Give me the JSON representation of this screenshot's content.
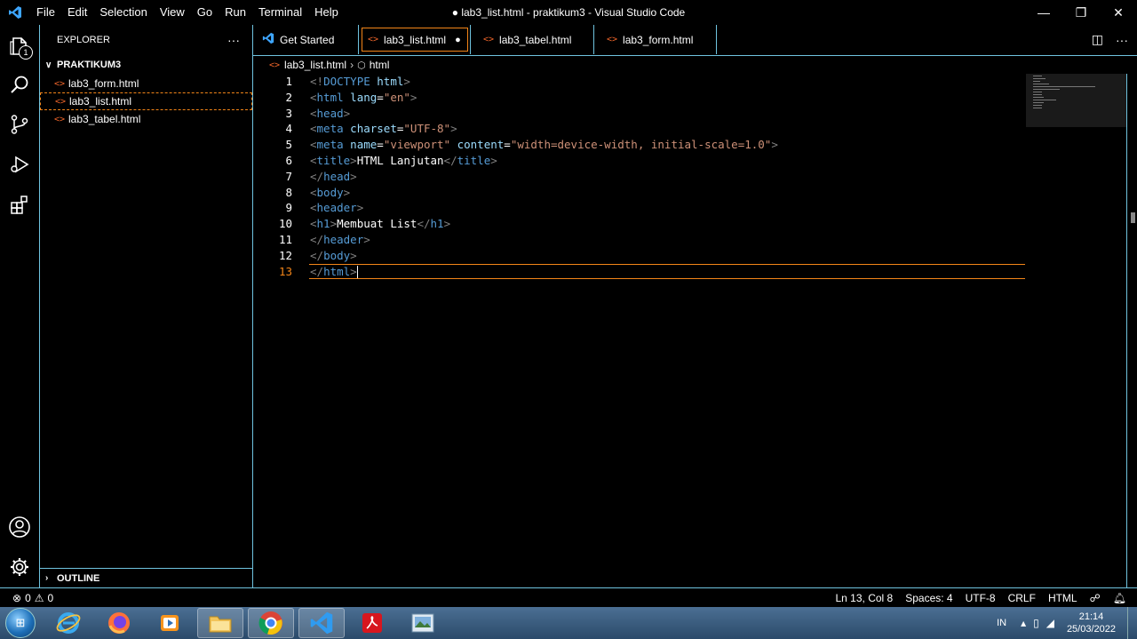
{
  "window": {
    "title": "● lab3_list.html - praktikum3 - Visual Studio Code",
    "menu": [
      "File",
      "Edit",
      "Selection",
      "View",
      "Go",
      "Run",
      "Terminal",
      "Help"
    ],
    "minimize": "—",
    "restore": "❐",
    "close": "✕"
  },
  "activity_bar": {
    "explorer_badge": "1",
    "items": [
      "explorer-icon",
      "search-icon",
      "source-control-icon",
      "run-debug-icon",
      "extensions-icon",
      "account-icon",
      "gear-icon"
    ]
  },
  "sidebar": {
    "header": "EXPLORER",
    "more": "···",
    "folder": "PRAKTIKUM3",
    "files": [
      {
        "name": "lab3_form.html",
        "active": false
      },
      {
        "name": "lab3_list.html",
        "active": true
      },
      {
        "name": "lab3_tabel.html",
        "active": false
      }
    ],
    "outline": "OUTLINE"
  },
  "tabs": [
    {
      "label": "Get Started",
      "active": false,
      "dirty": false
    },
    {
      "label": "lab3_list.html",
      "active": true,
      "dirty": true
    },
    {
      "label": "lab3_tabel.html",
      "active": false,
      "dirty": false
    },
    {
      "label": "lab3_form.html",
      "active": false,
      "dirty": false
    }
  ],
  "tab_actions": {
    "split": "◫",
    "more": "···"
  },
  "breadcrumb": {
    "file": "lab3_list.html",
    "symbol": "html"
  },
  "editor": {
    "current_line": 13,
    "lines": [
      [
        [
          "br",
          "<!"
        ],
        [
          "tag",
          "DOCTYPE"
        ],
        [
          "txt",
          " "
        ],
        [
          "at",
          "html"
        ],
        [
          "br",
          ">"
        ]
      ],
      [
        [
          "br",
          "<"
        ],
        [
          "tag",
          "html"
        ],
        [
          "txt",
          " "
        ],
        [
          "at",
          "lang"
        ],
        [
          "txt",
          "="
        ],
        [
          "str",
          "\"en\""
        ],
        [
          "br",
          ">"
        ]
      ],
      [
        [
          "br",
          "<"
        ],
        [
          "tag",
          "head"
        ],
        [
          "br",
          ">"
        ]
      ],
      [
        [
          "br",
          "<"
        ],
        [
          "tag",
          "meta"
        ],
        [
          "txt",
          " "
        ],
        [
          "at",
          "charset"
        ],
        [
          "txt",
          "="
        ],
        [
          "str",
          "\"UTF-8\""
        ],
        [
          "br",
          ">"
        ]
      ],
      [
        [
          "br",
          "<"
        ],
        [
          "tag",
          "meta"
        ],
        [
          "txt",
          " "
        ],
        [
          "at",
          "name"
        ],
        [
          "txt",
          "="
        ],
        [
          "str",
          "\"viewport\""
        ],
        [
          "txt",
          " "
        ],
        [
          "at",
          "content"
        ],
        [
          "txt",
          "="
        ],
        [
          "str",
          "\"width=device-width, initial-scale=1.0\""
        ],
        [
          "br",
          ">"
        ]
      ],
      [
        [
          "br",
          "<"
        ],
        [
          "tag",
          "title"
        ],
        [
          "br",
          ">"
        ],
        [
          "txt",
          "HTML Lanjutan"
        ],
        [
          "br",
          "</"
        ],
        [
          "tag",
          "title"
        ],
        [
          "br",
          ">"
        ]
      ],
      [
        [
          "br",
          "</"
        ],
        [
          "tag",
          "head"
        ],
        [
          "br",
          ">"
        ]
      ],
      [
        [
          "br",
          "<"
        ],
        [
          "tag",
          "body"
        ],
        [
          "br",
          ">"
        ]
      ],
      [
        [
          "br",
          "<"
        ],
        [
          "tag",
          "header"
        ],
        [
          "br",
          ">"
        ]
      ],
      [
        [
          "br",
          "<"
        ],
        [
          "tag",
          "h1"
        ],
        [
          "br",
          ">"
        ],
        [
          "txt",
          "Membuat List"
        ],
        [
          "br",
          "</"
        ],
        [
          "tag",
          "h1"
        ],
        [
          "br",
          ">"
        ]
      ],
      [
        [
          "br",
          "</"
        ],
        [
          "tag",
          "header"
        ],
        [
          "br",
          ">"
        ]
      ],
      [
        [
          "br",
          "</"
        ],
        [
          "tag",
          "body"
        ],
        [
          "br",
          ">"
        ]
      ],
      [
        [
          "br",
          "</"
        ],
        [
          "tag",
          "html"
        ],
        [
          "br",
          ">"
        ]
      ]
    ]
  },
  "status": {
    "errors": "0",
    "warnings": "0",
    "position": "Ln 13, Col 8",
    "spaces": "Spaces: 4",
    "encoding": "UTF-8",
    "eol": "CRLF",
    "language": "HTML"
  },
  "taskbar": {
    "apps": [
      "internet-explorer",
      "firefox",
      "media-player",
      "file-explorer",
      "chrome",
      "vscode",
      "acrobat",
      "photo-viewer"
    ],
    "lang": "IN",
    "time": "21:14",
    "date": "25/03/2022"
  },
  "colors": {
    "accent_border": "#6fc3df",
    "active_outline": "#f38518",
    "html_icon": "#f1662a"
  }
}
